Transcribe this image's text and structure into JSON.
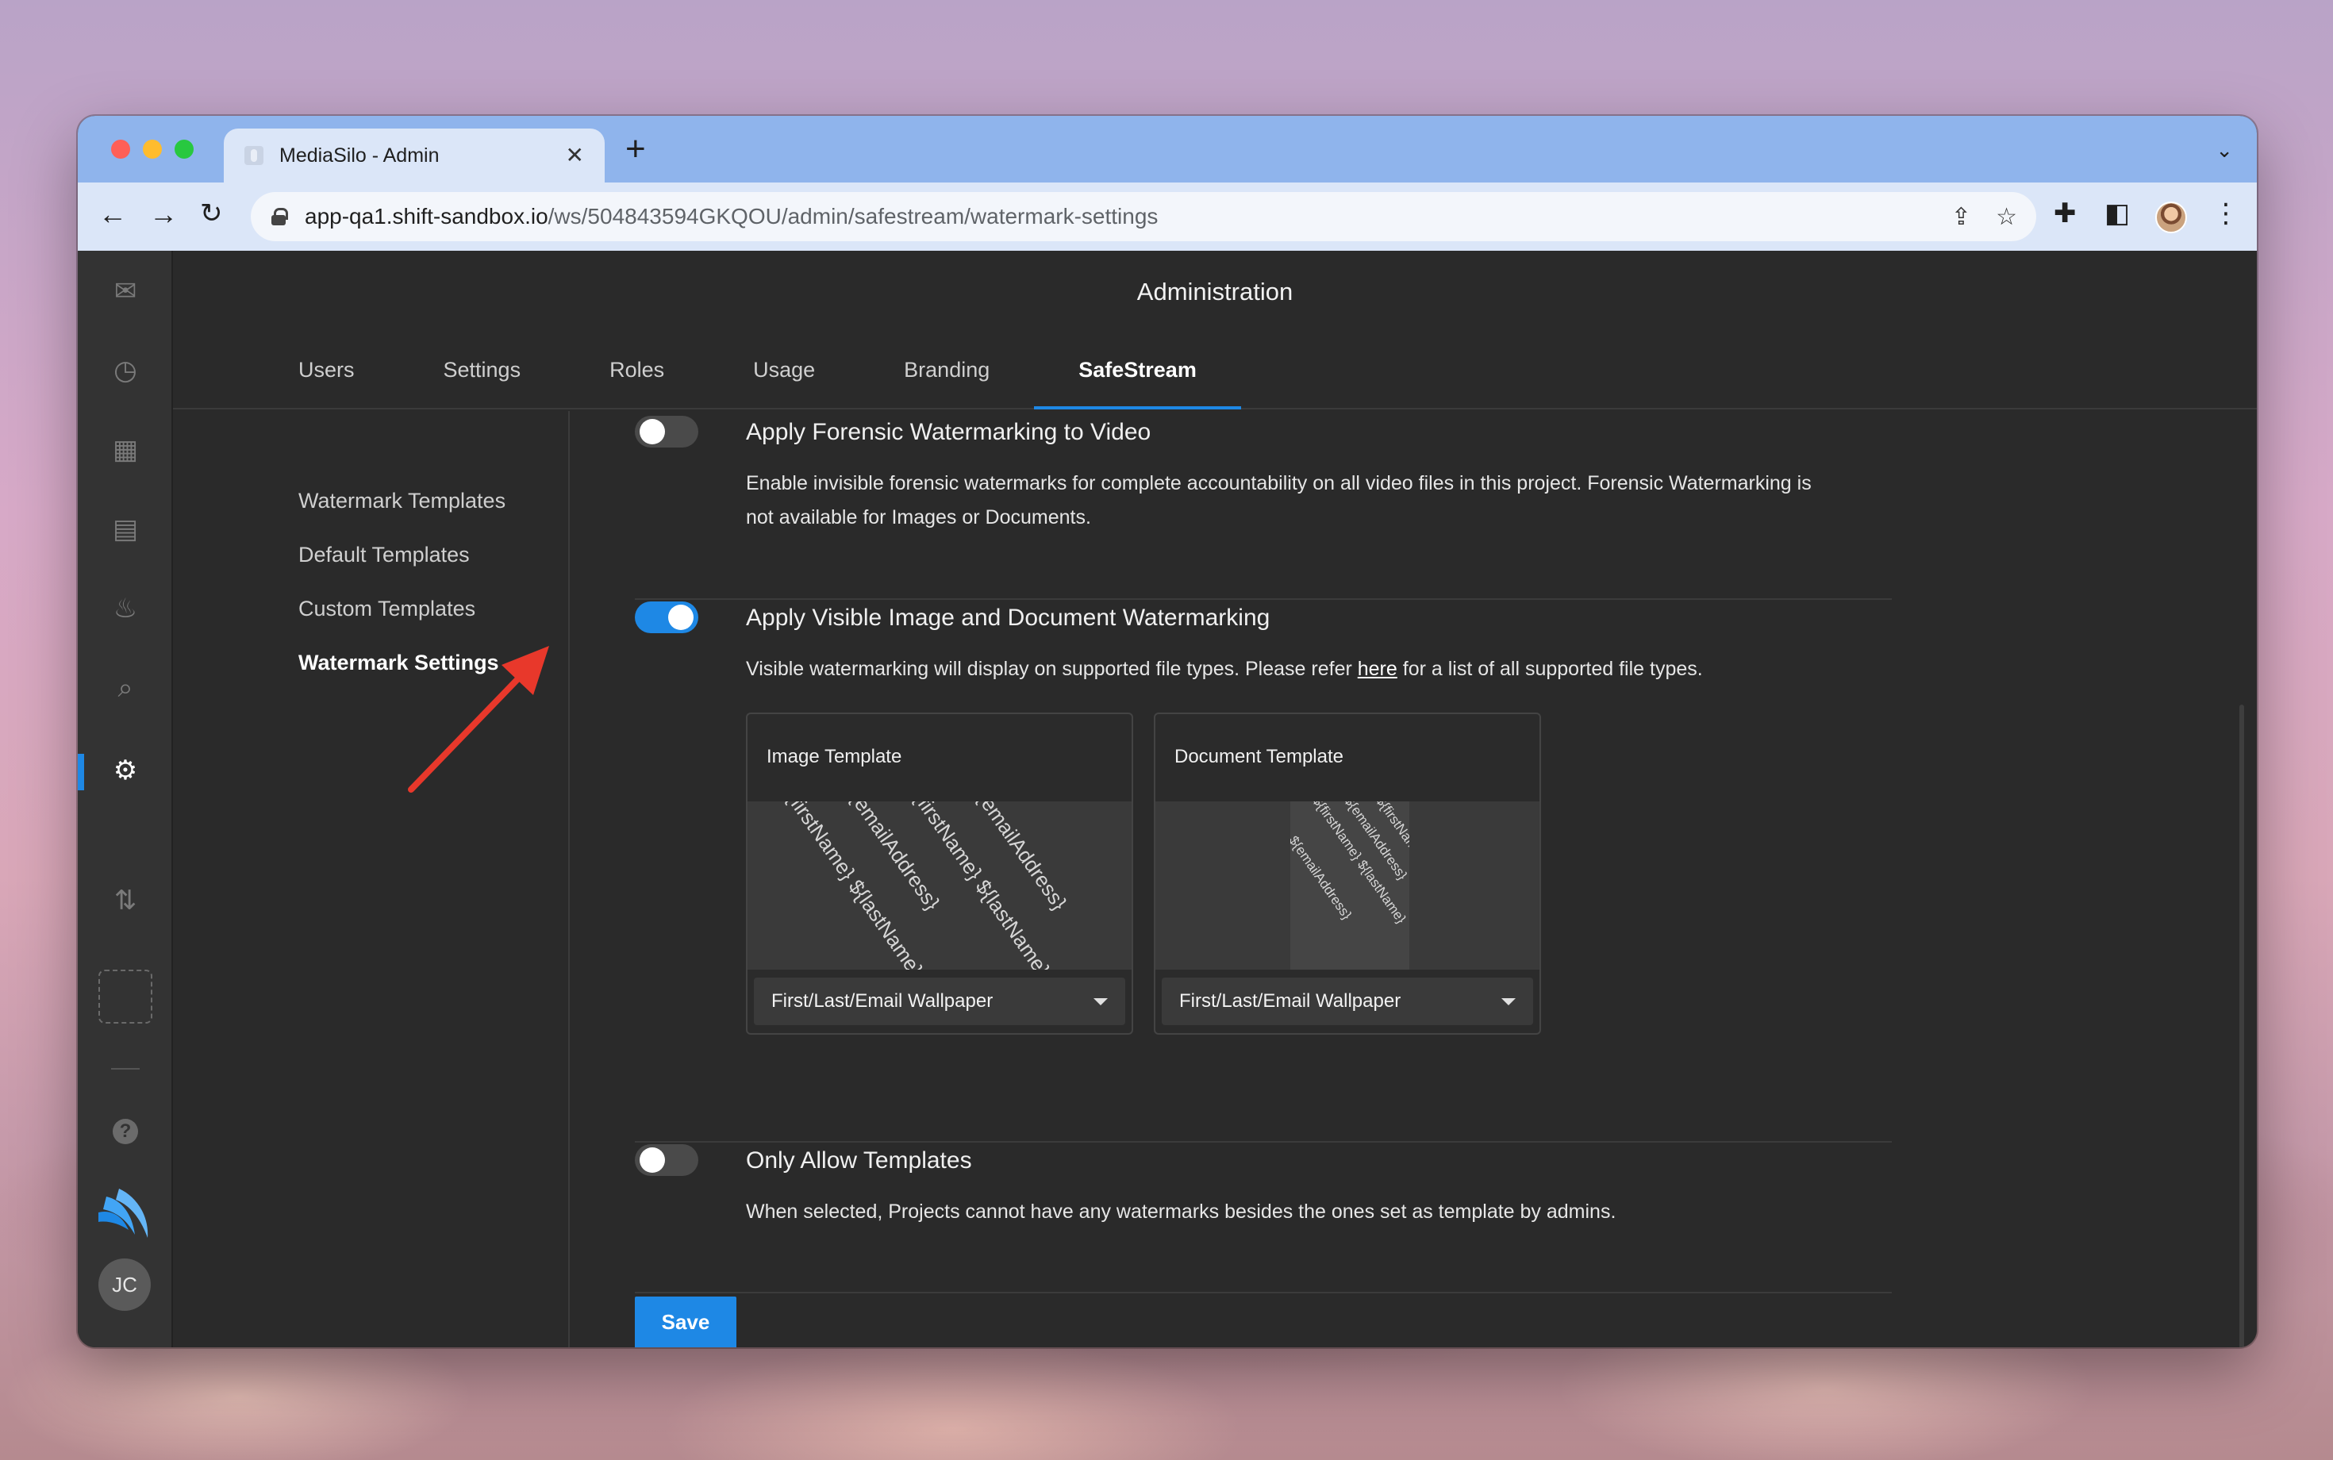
{
  "browser": {
    "tab_title": "MediaSilo - Admin",
    "tab_close": "✕",
    "new_tab": "+",
    "url_host": "app-qa1.shift-sandbox.io",
    "url_path": "/ws/504843594GKQOU/admin/safestream/watermark-settings"
  },
  "app": {
    "title": "Administration",
    "tabs": [
      {
        "label": "Users"
      },
      {
        "label": "Settings"
      },
      {
        "label": "Roles"
      },
      {
        "label": "Usage"
      },
      {
        "label": "Branding"
      },
      {
        "label": "SafeStream",
        "active": true
      }
    ],
    "subnav": [
      {
        "label": "Watermark Templates"
      },
      {
        "label": "Default Templates"
      },
      {
        "label": "Custom Templates"
      },
      {
        "label": "Watermark Settings",
        "active": true
      }
    ],
    "user_initials": "JC",
    "rail_icons": [
      "mail-icon",
      "clock-icon",
      "chart-icon",
      "archive-icon",
      "flame-icon",
      "search-icon",
      "gear-icon",
      "transfer-icon",
      "help-icon"
    ]
  },
  "settings": {
    "forensic": {
      "title": "Apply Forensic Watermarking to Video",
      "description": "Enable invisible forensic watermarks for complete accountability on all video files in this project. Forensic Watermarking is not available for Images or Documents.",
      "enabled": false
    },
    "visible": {
      "title": "Apply Visible Image and Document Watermarking",
      "description_before": "Visible watermarking will display on supported file types. Please refer ",
      "link_text": "here",
      "description_after": " for a list of all supported file types.",
      "enabled": true,
      "image_template": {
        "label": "Image Template",
        "selected": "First/Last/Email Wallpaper",
        "preview_lines": [
          "${firstName} ${lastName}",
          "${emailAddress}",
          "${firstName} ${lastName}",
          "${emailAddress}"
        ]
      },
      "document_template": {
        "label": "Document Template",
        "selected": "First/Last/Email Wallpaper",
        "preview_lines": [
          "${firstName} ${lastName}",
          "${emailAddress}",
          "${firstName} ${lastName}",
          "${emailAddress}"
        ]
      }
    },
    "only_templates": {
      "title": "Only Allow Templates",
      "description": "When selected, Projects cannot have any watermarks besides the ones set as template by admins.",
      "enabled": false
    },
    "save_label": "Save"
  },
  "colors": {
    "accent": "#1e88e5",
    "annotation_arrow": "#e8382b"
  }
}
